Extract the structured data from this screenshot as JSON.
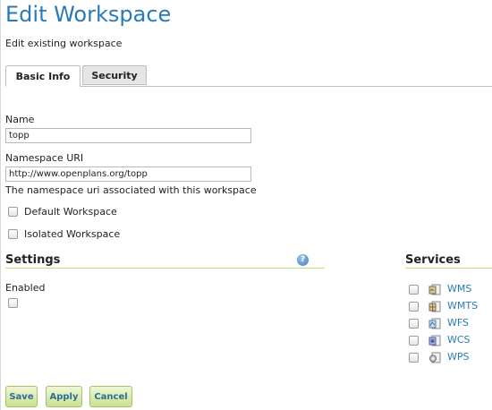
{
  "page": {
    "title": "Edit Workspace",
    "subtitle": "Edit existing workspace"
  },
  "tabs": [
    {
      "label": "Basic Info",
      "active": true
    },
    {
      "label": "Security",
      "active": false
    }
  ],
  "form": {
    "name_label": "Name",
    "name_value": "topp",
    "uri_label": "Namespace URI",
    "uri_value": "http://www.openplans.org/topp",
    "uri_help": "The namespace uri associated with this workspace",
    "default_label": "Default Workspace",
    "default_checked": false,
    "isolated_label": "Isolated Workspace",
    "isolated_checked": false
  },
  "settings": {
    "title": "Settings",
    "help_icon": "help-icon",
    "help_glyph": "?",
    "enabled_label": "Enabled",
    "enabled_checked": false
  },
  "services": {
    "title": "Services",
    "items": [
      {
        "label": "WMS",
        "icon": "map-icon",
        "checked": false
      },
      {
        "label": "WMTS",
        "icon": "tile-map-icon",
        "checked": false
      },
      {
        "label": "WFS",
        "icon": "feature-icon",
        "checked": false
      },
      {
        "label": "WCS",
        "icon": "coverage-icon",
        "checked": false
      },
      {
        "label": "WPS",
        "icon": "process-gear-icon",
        "checked": false
      }
    ]
  },
  "buttons": {
    "save": "Save",
    "apply": "Apply",
    "cancel": "Cancel"
  },
  "colors": {
    "title": "#2a7bb5",
    "link": "#2a7bb5",
    "section_rule": "#c9d97e",
    "button_top": "#eef7d6",
    "button_bottom": "#c9e18f",
    "button_text": "#2f6d96"
  }
}
